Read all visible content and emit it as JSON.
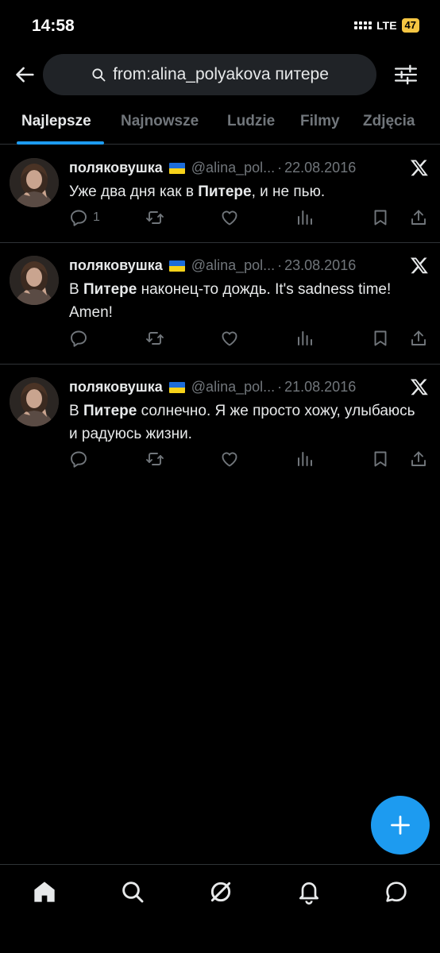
{
  "status_bar": {
    "time": "14:58",
    "network": "LTE",
    "battery": "47"
  },
  "search": {
    "query": "from:alina_polyakova питере"
  },
  "tabs": [
    {
      "label": "Najlepsze",
      "active": true
    },
    {
      "label": "Najnowsze",
      "active": false
    },
    {
      "label": "Ludzie",
      "active": false
    },
    {
      "label": "Filmy",
      "active": false
    },
    {
      "label": "Zdjęcia",
      "active": false
    }
  ],
  "tweets": [
    {
      "name": "поляковушка",
      "handle": "@alina_pol...",
      "dot": "·",
      "date": "22.08.2016",
      "text_before": "Уже два дня как в ",
      "text_bold": "Питере",
      "text_after": ", и не пью.",
      "reply_count": "1"
    },
    {
      "name": "поляковушка",
      "handle": "@alina_pol...",
      "dot": "·",
      "date": "23.08.2016",
      "text_before": "В ",
      "text_bold": "Питере",
      "text_after": " наконец-то дождь. It's sadness time! Amen!",
      "reply_count": ""
    },
    {
      "name": "поляковушка",
      "handle": "@alina_pol...",
      "dot": "·",
      "date": "21.08.2016",
      "text_before": "В ",
      "text_bold": "Питере",
      "text_after": " солнечно. Я же просто хожу, улыбаюсь и радуюсь жизни.",
      "reply_count": ""
    }
  ],
  "colors": {
    "accent": "#1d9bf0",
    "muted": "#71767b",
    "text": "#e7e9ea",
    "divider": "#2f3336"
  },
  "bottom_nav": [
    "home-icon",
    "search-icon",
    "grok-icon",
    "notifications-icon",
    "messages-icon"
  ]
}
